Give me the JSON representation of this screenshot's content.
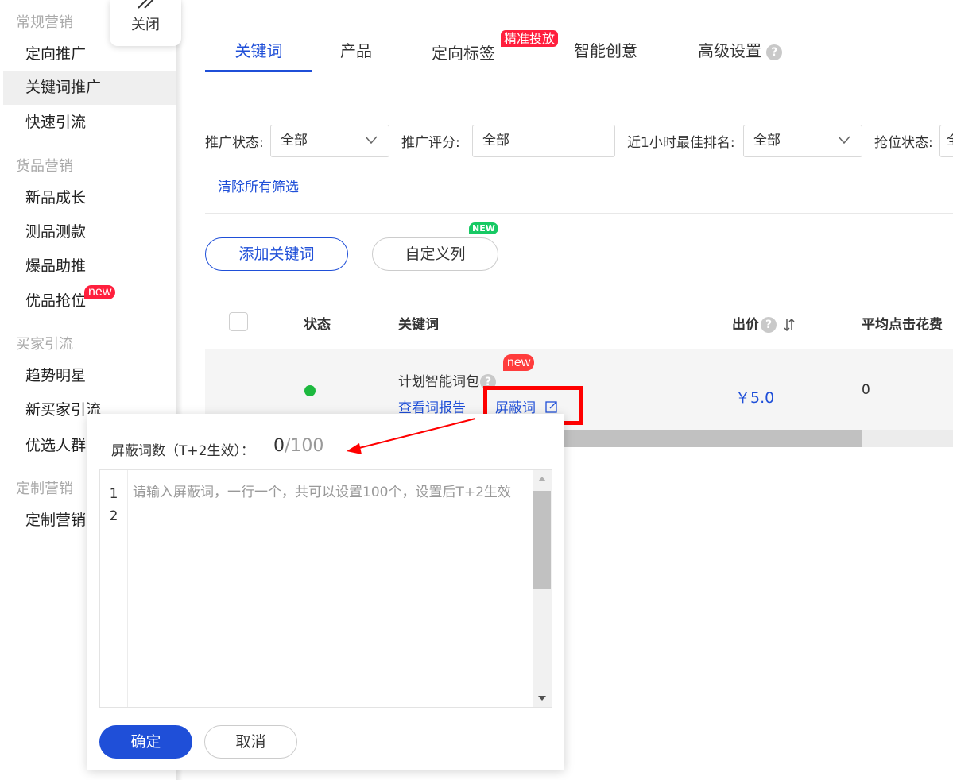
{
  "close": {
    "label": "关闭"
  },
  "sidebar": {
    "groups": [
      {
        "label": "常规营销",
        "items": [
          {
            "label": "定向推广"
          },
          {
            "label": "关键词推广",
            "active": true
          },
          {
            "label": "快速引流"
          }
        ]
      },
      {
        "label": "货品营销",
        "items": [
          {
            "label": "新品成长"
          },
          {
            "label": "测品测款"
          },
          {
            "label": "爆品助推"
          },
          {
            "label": "优品抢位",
            "tag": "new"
          }
        ]
      },
      {
        "label": "买家引流",
        "items": [
          {
            "label": "趋势明星"
          },
          {
            "label": "新买家引流"
          },
          {
            "label": "优选人群"
          }
        ]
      },
      {
        "label": "定制营销",
        "items": [
          {
            "label": "定制营销"
          }
        ]
      }
    ]
  },
  "tabs": [
    {
      "label": "关键词",
      "active": true
    },
    {
      "label": "产品"
    },
    {
      "label": "定向标签",
      "badge": "精准投放"
    },
    {
      "label": "智能创意"
    },
    {
      "label": "高级设置",
      "help": true
    }
  ],
  "filters": {
    "status_label": "推广状态:",
    "status_value": "全部",
    "score_label": "推广评分:",
    "score_value": "全部",
    "rank_label": "近1小时最佳排名:",
    "rank_value": "全部",
    "grab_label": "抢位状态:",
    "grab_value": "全",
    "clear_all": "清除所有筛选"
  },
  "actions": {
    "add_keyword": "添加关键词",
    "custom_columns": "自定义列",
    "custom_columns_badge": "NEW"
  },
  "table": {
    "headers": {
      "status": "状态",
      "keyword": "关键词",
      "bid": "出价",
      "avg_cpc": "平均点击花费"
    },
    "row": {
      "keyword": "计划智能词包",
      "keyword_badge": "new",
      "view_report": "查看词报告",
      "blocked_words": "屏蔽词",
      "bid": "￥5.0",
      "avg_cpc": "0"
    }
  },
  "popover": {
    "label": "屏蔽词数（T+2生效）：",
    "count": "0",
    "total": "/100",
    "line_numbers": [
      "1",
      "2"
    ],
    "placeholder": "请输入屏蔽词，一行一个，共可以设置100个，设置后T+2生效",
    "confirm": "确定",
    "cancel": "取消"
  },
  "colors": {
    "accent": "#1f4fd8",
    "highlight_box": "#ff0000",
    "status_on": "#1db93f",
    "new_badge": "#ff1f3d",
    "new_green": "#17c964"
  },
  "icons": {
    "edit": "edit-icon",
    "help": "help-icon",
    "sort": "sort-icon",
    "dropdown": "chevron-down-icon"
  }
}
